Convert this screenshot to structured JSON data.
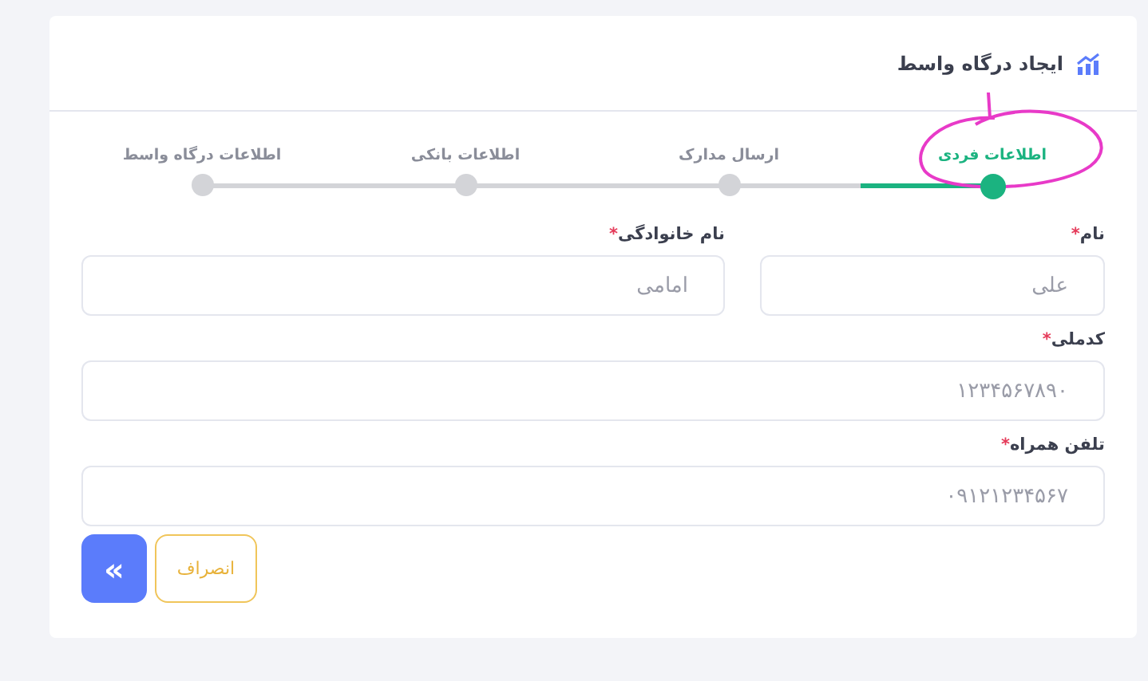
{
  "header": {
    "title": "ایجاد درگاه واسط"
  },
  "steps": [
    {
      "label": "اطلاعات فردی",
      "selected": true
    },
    {
      "label": "ارسال مدارک",
      "selected": false
    },
    {
      "label": "اطلاعات بانکی",
      "selected": false
    },
    {
      "label": "اطلاعات درگاه واسط",
      "selected": false
    }
  ],
  "form_rows": [
    [
      {
        "label": "نام",
        "mark": "*",
        "placeholder": "علی"
      },
      {
        "label": "نام خانوادگی",
        "mark": "*",
        "placeholder": "امامی"
      }
    ],
    [
      {
        "label": "کدملی",
        "mark": "*",
        "placeholder": "۱۲۳۴۵۶۷۸۹۰"
      }
    ],
    [
      {
        "label": "تلفن همراه",
        "mark": "*",
        "placeholder": "۰۹۱۲۱۲۳۴۵۶۷"
      }
    ]
  ],
  "buttons": {
    "next": "«",
    "cancel": "انصراف"
  }
}
